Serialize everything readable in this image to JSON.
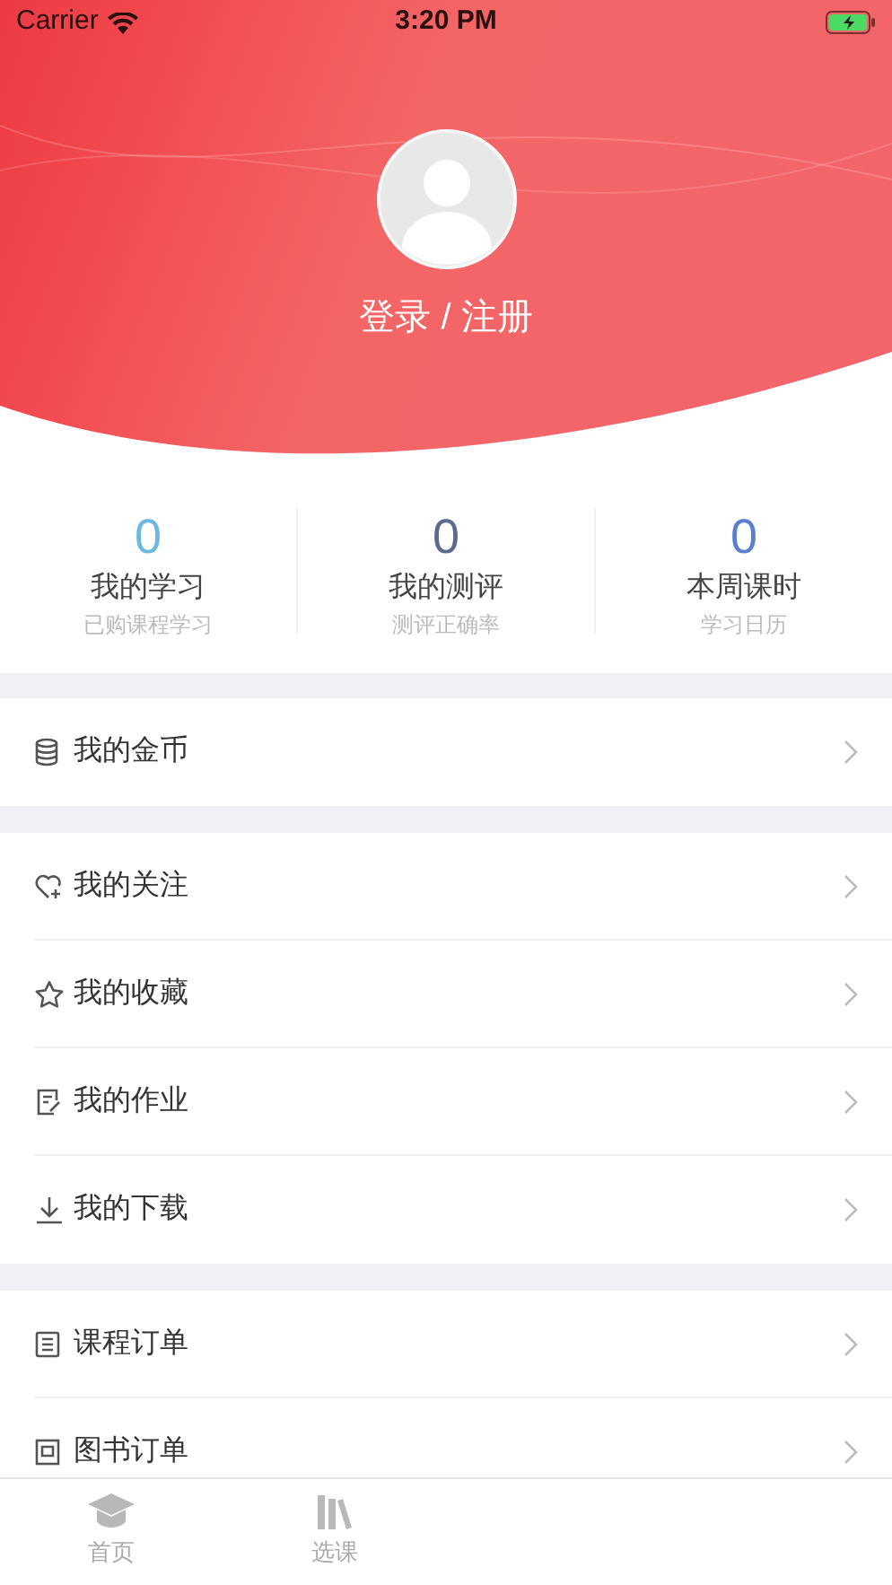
{
  "status_bar": {
    "carrier": "Carrier",
    "time": "3:20 PM"
  },
  "profile": {
    "login_label": "登录 / 注册"
  },
  "stats": [
    {
      "value": "0",
      "label": "我的学习",
      "caption": "已购课程学习",
      "color": "#6bb8e0"
    },
    {
      "value": "0",
      "label": "我的测评",
      "caption": "测评正确率",
      "color": "#5d6a8c"
    },
    {
      "value": "0",
      "label": "本周课时",
      "caption": "学习日历",
      "color": "#5b7fcf"
    }
  ],
  "menu_groups": [
    {
      "items": [
        {
          "label": "我的金币"
        }
      ]
    },
    {
      "items": [
        {
          "label": "我的关注"
        },
        {
          "label": "我的收藏"
        },
        {
          "label": "我的作业"
        },
        {
          "label": "我的下载"
        }
      ]
    },
    {
      "items": [
        {
          "label": "课程订单"
        },
        {
          "label": "图书订单"
        }
      ]
    }
  ],
  "tab_bar": [
    {
      "label": "首页"
    },
    {
      "label": "选课"
    }
  ]
}
